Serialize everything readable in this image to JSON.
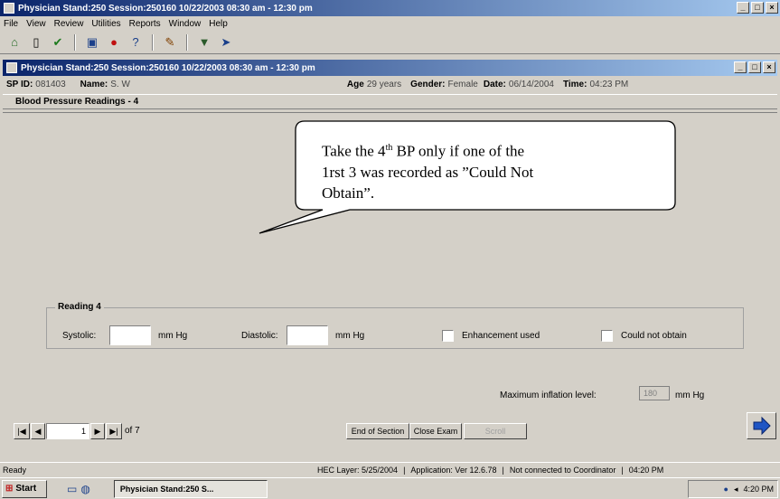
{
  "window": {
    "title": "Physician Stand:250 Session:250160 10/22/2003 08:30 am - 12:30 pm"
  },
  "menu": [
    "File",
    "View",
    "Review",
    "Utilities",
    "Reports",
    "Window",
    "Help"
  ],
  "child_window": {
    "title": "Physician Stand:250 Session:250160 10/22/2003 08:30 am - 12:30 pm"
  },
  "info": {
    "sp_label": "SP ID:",
    "sp_value": "081403",
    "name_label": "Name:",
    "name_value": "S. W",
    "age_label": "Age",
    "age_value": "29 years",
    "gender_label": "Gender:",
    "gender_value": "Female",
    "date_label": "Date:",
    "date_value": "06/14/2004",
    "time_label": "Time:",
    "time_value": "04:23 PM"
  },
  "section": {
    "title": "Blood Pressure Readings - 4"
  },
  "callout": {
    "line1_pre": "Take the 4",
    "line1_sup": "th",
    "line1_post": " BP only if one of the",
    "line2": "1rst 3 was recorded as  ”Could Not",
    "line3": "Obtain”."
  },
  "reading": {
    "group_title": "Reading 4",
    "systolic_label": "Systolic:",
    "systolic_value": "",
    "systolic_unit": "mm Hg",
    "diastolic_label": "Diastolic:",
    "diastolic_value": "",
    "diastolic_unit": "mm Hg",
    "enhancement_label": "Enhancement used",
    "enhancement_checked": false,
    "could_not_obtain_label": "Could not obtain",
    "could_not_obtain_checked": false
  },
  "inflation": {
    "label": "Maximum inflation level:",
    "value": "180",
    "unit": "mm Hg"
  },
  "nav": {
    "page_value": "1",
    "page_of": "of 7",
    "end_of_section": "End of Section",
    "close_exam": "Close Exam",
    "third_button": "Scroll"
  },
  "status": {
    "ready": "Ready",
    "layer": "HEC Layer: 5/25/2004",
    "app_version": "Application: Ver 12.6.78",
    "connection": "Not connected to Coordinator",
    "time": "04:20 PM"
  },
  "taskbar": {
    "start": "Start",
    "task": "Physician Stand:250 S...",
    "clock": "4:20 PM"
  }
}
